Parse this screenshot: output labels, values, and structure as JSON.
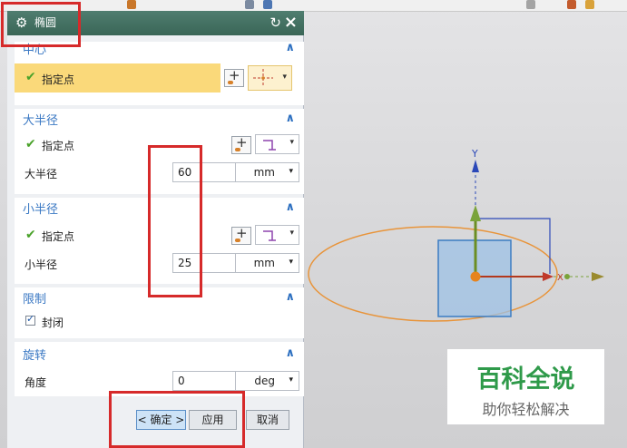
{
  "dialog": {
    "title": "椭圆",
    "sections": {
      "center": {
        "header": "中心",
        "point_label": "指定点"
      },
      "major": {
        "header": "大半径",
        "point_label": "指定点",
        "radius_label": "大半径",
        "radius_value": "60",
        "unit": "mm"
      },
      "minor": {
        "header": "小半径",
        "point_label": "指定点",
        "radius_label": "小半径",
        "radius_value": "25",
        "unit": "mm"
      },
      "limits": {
        "header": "限制",
        "closed_label": "封闭",
        "closed_checked": true
      },
      "rotation": {
        "header": "旋转",
        "angle_label": "角度",
        "angle_value": "0",
        "unit": "deg"
      }
    },
    "buttons": {
      "ok": "< 确定 >",
      "apply": "应用",
      "cancel": "取消"
    }
  },
  "viewport": {
    "axis_y_label": "Y",
    "axis_x_label": "X",
    "ellipse_color": "#e8943a",
    "plane_color": "#9ec2e6"
  },
  "watermark": {
    "main": "百科全说",
    "sub": "助你轻松解决"
  },
  "colors": {
    "title_bar": "#3e6b5c",
    "highlight": "#fad97a",
    "annotation": "#d62a2a",
    "section_header": "#3a78c3"
  }
}
